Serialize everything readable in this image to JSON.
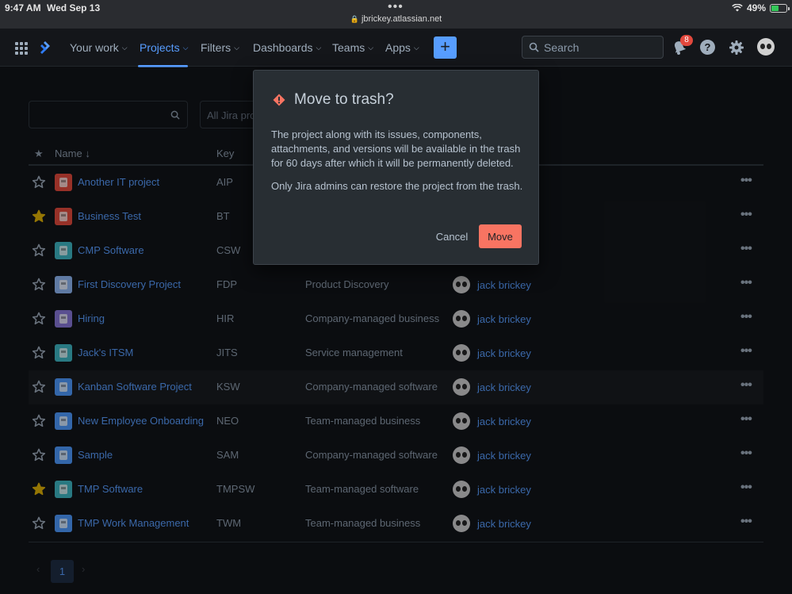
{
  "status_bar": {
    "time": "9:47 AM",
    "date": "Wed Sep 13",
    "url": "jbrickey.atlassian.net",
    "battery": "49%",
    "battery_level": 0.49
  },
  "nav": {
    "items": [
      {
        "label": "Your work"
      },
      {
        "label": "Projects"
      },
      {
        "label": "Filters"
      },
      {
        "label": "Dashboards"
      },
      {
        "label": "Teams"
      },
      {
        "label": "Apps"
      }
    ],
    "create_label": "+",
    "search_placeholder": "Search",
    "notification_count": "8",
    "help_label": "?"
  },
  "filters": {
    "search_value": "",
    "product_select": "All Jira pro"
  },
  "table": {
    "columns": {
      "name": "Name",
      "key": "Key"
    },
    "rows": [
      {
        "name": "Another IT project",
        "key": "AIP",
        "type": "",
        "lead": "",
        "starred": false,
        "icon": "window-icon",
        "color": "#e5493a"
      },
      {
        "name": "Business Test",
        "key": "BT",
        "type": "",
        "lead": "",
        "starred": true,
        "icon": "tools-icon",
        "color": "#e5493a"
      },
      {
        "name": "CMP Software",
        "key": "CSW",
        "type": "",
        "lead": "",
        "starred": false,
        "icon": "robot-icon",
        "color": "#3db7c4"
      },
      {
        "name": "First Discovery Project",
        "key": "FDP",
        "type": "Product Discovery",
        "lead": "jack brickey",
        "starred": false,
        "icon": "mountain-icon",
        "color": "#8fb8f6"
      },
      {
        "name": "Hiring",
        "key": "HIR",
        "type": "Company-managed business",
        "lead": "jack brickey",
        "starred": false,
        "icon": "parrot-icon",
        "color": "#8777d9"
      },
      {
        "name": "Jack's ITSM",
        "key": "JITS",
        "type": "Service management",
        "lead": "jack brickey",
        "starred": false,
        "icon": "robot-icon",
        "color": "#3db7c4"
      },
      {
        "name": "Kanban Software Project",
        "key": "KSW",
        "type": "Company-managed software",
        "lead": "jack brickey",
        "starred": false,
        "icon": "cloud-icon",
        "color": "#4c9aff"
      },
      {
        "name": "New Employee Onboarding",
        "key": "NEO",
        "type": "Team-managed business",
        "lead": "jack brickey",
        "starred": false,
        "icon": "phone-icon",
        "color": "#4c9aff"
      },
      {
        "name": "Sample",
        "key": "SAM",
        "type": "Company-managed software",
        "lead": "jack brickey",
        "starred": false,
        "icon": "cloud-icon",
        "color": "#4c9aff"
      },
      {
        "name": "TMP Software",
        "key": "TMPSW",
        "type": "Team-managed software",
        "lead": "jack brickey",
        "starred": true,
        "icon": "notebook-icon",
        "color": "#3db7c4"
      },
      {
        "name": "TMP Work Management",
        "key": "TWM",
        "type": "Team-managed business",
        "lead": "jack brickey",
        "starred": false,
        "icon": "phone-icon",
        "color": "#4c9aff"
      }
    ],
    "more_label": "•••"
  },
  "pagination": {
    "prev": "‹",
    "current_page": "1",
    "next": "›"
  },
  "modal": {
    "title": "Move to trash?",
    "body1": "The project along with its issues, components, attachments, and versions will be available in the trash for 60 days after which it will be permanently deleted.",
    "body2": "Only Jira admins can restore the project from the trash.",
    "cancel_label": "Cancel",
    "move_label": "Move"
  },
  "colors": {
    "accent": "#579dff",
    "danger": "#f87462",
    "star_filled": "#e2b203"
  }
}
